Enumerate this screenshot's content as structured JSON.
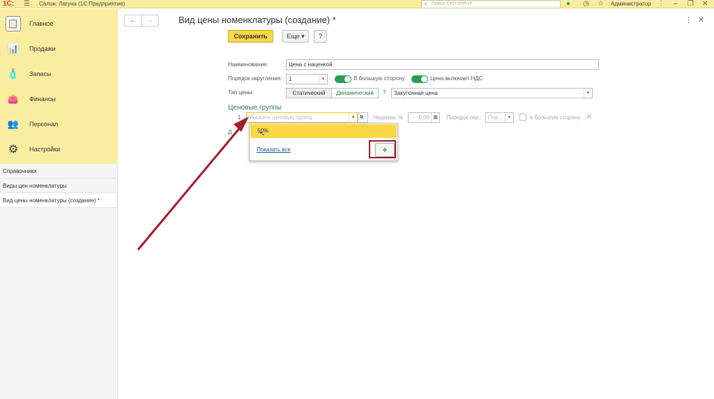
{
  "topbar": {
    "logo": "1С:",
    "app_title": "Салон: Лагуна  (1С:Предприятие)",
    "search_placeholder": "Поиск Ctrl+Shift+F",
    "user": "Администратор"
  },
  "sidebar": {
    "items": [
      {
        "label": "Главное",
        "icon": "clipboard-icon"
      },
      {
        "label": "Продажи",
        "icon": "sales-chart-icon"
      },
      {
        "label": "Запасы",
        "icon": "stock-icon"
      },
      {
        "label": "Финансы",
        "icon": "wallet-icon"
      },
      {
        "label": "Персонал",
        "icon": "people-icon"
      },
      {
        "label": "Настройки",
        "icon": "gear-icon"
      }
    ]
  },
  "history": {
    "items": [
      {
        "label": "Справочники"
      },
      {
        "label": "Виды цен номенклатуры"
      },
      {
        "label": "Вид цены номенклатуры (создание) *"
      }
    ]
  },
  "form": {
    "title": "Вид цены номенклатуры (создание) *",
    "save_label": "Сохранить",
    "more_label": "Еще",
    "help_label": "?",
    "name_label": "Наименование:",
    "name_value": "Цена с наценкой",
    "rounding_label": "Порядок округления:",
    "rounding_value": "1",
    "round_up_label": "В большую сторону",
    "vat_label": "Цена включает НДС",
    "price_type_label": "Тип цены:",
    "static_label": "Статический",
    "dynamic_label": "Динамический",
    "question": "?",
    "base_price_value": "Закупочная цена",
    "groups_title": "Ценовые группы",
    "row_number": "1",
    "group_placeholder": "Укажите ценовую группу",
    "markup_label": "Наценка, %",
    "markup_value": "0,00",
    "row_rounding_label": "Порядок окр.:",
    "row_rounding_placeholder": "Пор...",
    "row_round_up_label": "в большую сторону",
    "hidden_link_fragment": "Д"
  },
  "popup": {
    "selected_item": "50%",
    "show_all_label": "Показать все",
    "add_label": "+"
  },
  "colors": {
    "sidebar_bg": "#fbeda0",
    "save_button": "#f9d748",
    "toggle_on": "#2e9b55",
    "section_green": "#2e7d4f",
    "annotation_red": "#a31a2c"
  }
}
